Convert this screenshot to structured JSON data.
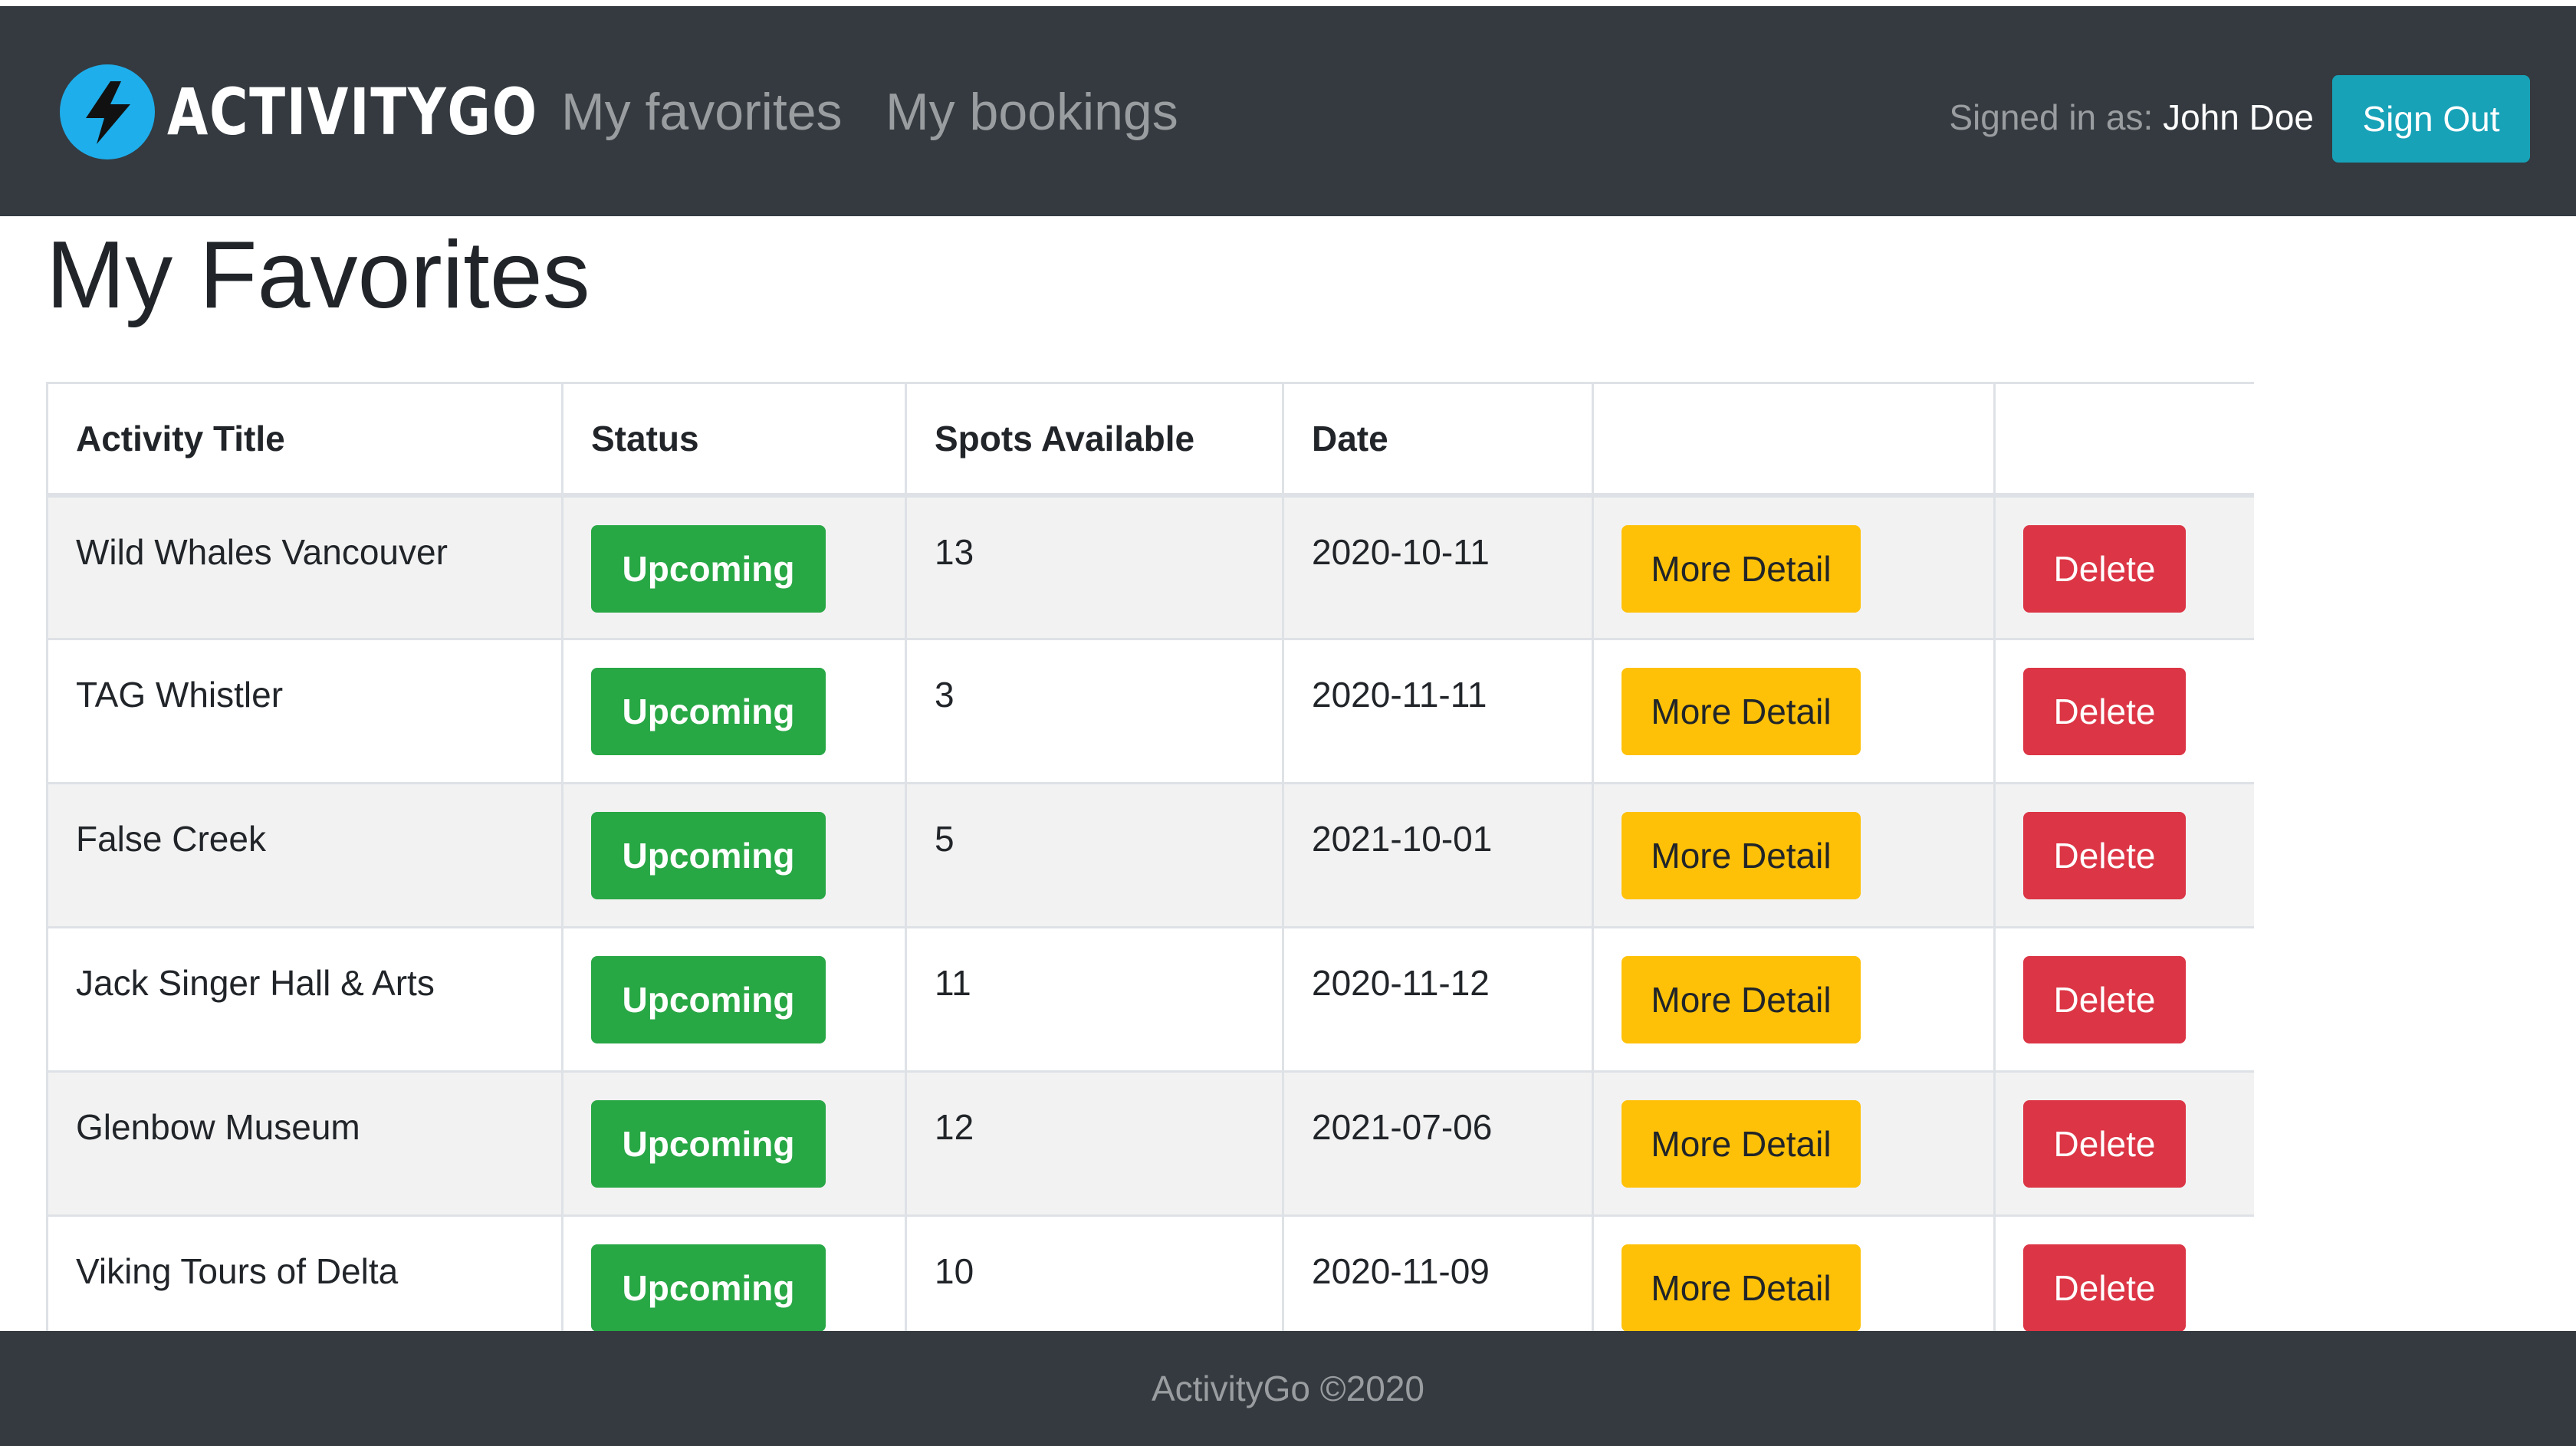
{
  "navbar": {
    "brand": "ActivityGo",
    "links": [
      {
        "label": "My favorites"
      },
      {
        "label": "My bookings"
      }
    ],
    "signed_in_label": "Signed in as:",
    "user_name": "John Doe",
    "sign_out_label": "Sign Out"
  },
  "main": {
    "title": "My Favorites",
    "table": {
      "headers": [
        "Activity Title",
        "Status",
        "Spots Available",
        "Date",
        "",
        ""
      ],
      "rows": [
        {
          "title": "Wild Whales Vancouver",
          "status": "Upcoming",
          "spots": "13",
          "date": "2020-10-11",
          "detail": "More Detail",
          "delete": "Delete"
        },
        {
          "title": "TAG Whistler",
          "status": "Upcoming",
          "spots": "3",
          "date": "2020-11-11",
          "detail": "More Detail",
          "delete": "Delete"
        },
        {
          "title": "False Creek",
          "status": "Upcoming",
          "spots": "5",
          "date": "2021-10-01",
          "detail": "More Detail",
          "delete": "Delete"
        },
        {
          "title": "Jack Singer Hall & Arts",
          "status": "Upcoming",
          "spots": "11",
          "date": "2020-11-12",
          "detail": "More Detail",
          "delete": "Delete"
        },
        {
          "title": "Glenbow Museum",
          "status": "Upcoming",
          "spots": "12",
          "date": "2021-07-06",
          "detail": "More Detail",
          "delete": "Delete"
        },
        {
          "title": "Viking Tours of Delta",
          "status": "Upcoming",
          "spots": "10",
          "date": "2020-11-09",
          "detail": "More Detail",
          "delete": "Delete"
        }
      ]
    }
  },
  "footer": {
    "text": "ActivityGo ©2020"
  },
  "colors": {
    "navbar": "#343a40",
    "logo": "#1eaeeb",
    "sign_out": "#17a2b8",
    "status_badge": "#28a745",
    "more_detail": "#ffc107",
    "delete": "#dc3545",
    "row_stripe": "#f2f2f2"
  },
  "icons": {
    "brand_logo": "lightning-bolt-icon"
  }
}
